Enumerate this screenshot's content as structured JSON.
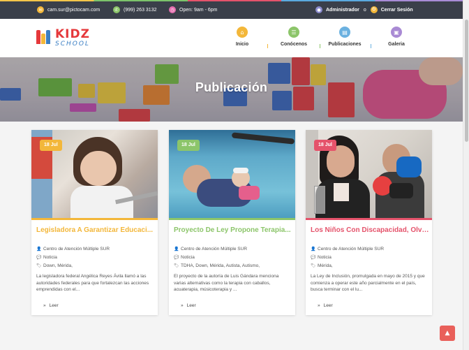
{
  "topbar": {
    "email": "cam.sur@pictocam.com",
    "phone": "(999) 263 3132",
    "hours": "Open: 9am - 6pm",
    "admin_link": "Administrador",
    "or_text": "o",
    "logout_link": "Cerrar Sesión"
  },
  "logo": {
    "line1": "KIDZ",
    "line2": "SCHOOL"
  },
  "nav": [
    {
      "label": "Inicio",
      "icon": "home-icon",
      "color": "#f3b73a"
    },
    {
      "label": "Conócenos",
      "icon": "list-icon",
      "color": "#8cc56a"
    },
    {
      "label": "Publicaciones",
      "icon": "document-icon",
      "color": "#6bb1e0"
    },
    {
      "label": "Galeria",
      "icon": "image-icon",
      "color": "#a98ad4"
    }
  ],
  "hero": {
    "title": "Publicación"
  },
  "posts": [
    {
      "date": "18 Jul",
      "accent": "#f3b73a",
      "title": "Legisladora A Garantizar Educaci...",
      "author": "Centro de Atención Múltiple SUR",
      "category": "Noticia",
      "tags": "Down, Mérida,",
      "excerpt": "La legisladora federal Angélica Reyes Ávila llamó a las autoridades federales para que fortalezcan las acciones emprendidas con el...",
      "read": "Leer"
    },
    {
      "date": "18 Jul",
      "accent": "#8cc56a",
      "title": "Proyecto De Ley Propone Terapia...",
      "author": "Centro de Atención Múltiple SUR",
      "category": "Noticia",
      "tags": "TDHA, Down, Mérida, Autista, Autismo,",
      "excerpt": "El proyecto de la autoría de Luis Gándara menciona varias alternativas como la terapia con caballos, acuaterapia, músicoterapia y ...",
      "read": "Leer"
    },
    {
      "date": "18 Jul",
      "accent": "#e5536b",
      "title": "Los Niños Con Discapacidad, Olvid...",
      "author": "Centro de Atención Múltiple SUR",
      "category": "Noticia",
      "tags": "Mérida,",
      "excerpt": "La Ley de Inclusión, promulgada en mayo de 2015 y que comienza a operar este año parcialmente en el país, busca terminar con el lu...",
      "read": "Leer"
    }
  ]
}
